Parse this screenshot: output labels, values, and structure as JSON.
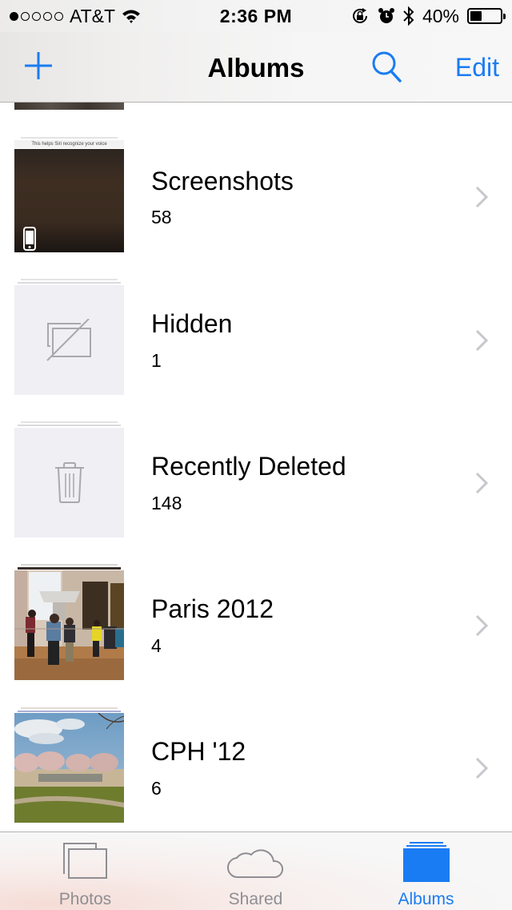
{
  "status_bar": {
    "signal_bars_filled": 1,
    "signal_bars_total": 5,
    "carrier": "AT&T",
    "wifi_icon": "wifi-icon",
    "time": "2:36 PM",
    "icons": [
      "rotation-lock-icon",
      "alarm-icon",
      "bluetooth-icon"
    ],
    "battery_percent_label": "40%",
    "battery_level": 0.4
  },
  "nav_bar": {
    "title": "Albums",
    "add_icon": "plus-icon",
    "search_icon": "search-icon",
    "edit_label": "Edit"
  },
  "albums": [
    {
      "name": "Screenshots",
      "count": "58",
      "thumb": "screenshot-image",
      "badge_icon": "iphone-icon"
    },
    {
      "name": "Hidden",
      "count": "1",
      "thumb": "placeholder",
      "placeholder_icon": "hidden-photos-icon"
    },
    {
      "name": "Recently Deleted",
      "count": "148",
      "thumb": "placeholder",
      "placeholder_icon": "trash-icon"
    },
    {
      "name": "Paris 2012",
      "count": "4",
      "thumb": "museum-photo"
    },
    {
      "name": "CPH '12",
      "count": "6",
      "thumb": "park-photo"
    }
  ],
  "tab_bar": {
    "tabs": [
      {
        "label": "Photos",
        "icon": "photos-icon",
        "active": false
      },
      {
        "label": "Shared",
        "icon": "cloud-icon",
        "active": false
      },
      {
        "label": "Albums",
        "icon": "albums-icon",
        "active": true
      }
    ]
  },
  "colors": {
    "accent": "#1a7cf3",
    "inactive_tab": "#8e8e93",
    "chevron": "#c7c7cc",
    "placeholder_bg": "#efeff4"
  }
}
